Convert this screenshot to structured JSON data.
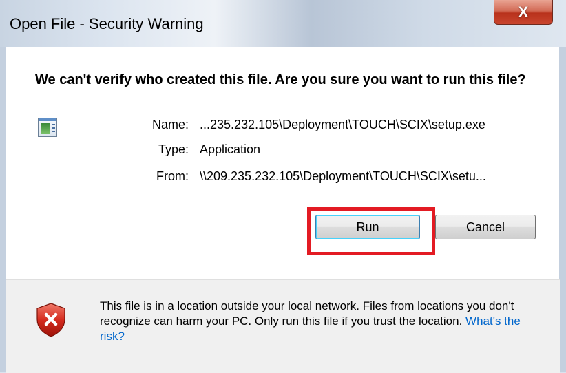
{
  "window": {
    "title": "Open File - Security Warning",
    "close_glyph": "X"
  },
  "dialog": {
    "heading": "We can't verify who created this file. Are you sure you want to run this file?",
    "file_icon": "application-file-icon",
    "fields": {
      "name_label": "Name:",
      "name_value": "...235.232.105\\Deployment\\TOUCH\\SCIX\\setup.exe",
      "type_label": "Type:",
      "type_value": "Application",
      "from_label": "From:",
      "from_value": "\\\\209.235.232.105\\Deployment\\TOUCH\\SCIX\\setu..."
    },
    "buttons": {
      "run_label": "Run",
      "cancel_label": "Cancel"
    }
  },
  "footer": {
    "warning_icon": "shield-error-icon",
    "message": "This file is in a location outside your local network. Files from locations you don't recognize can harm your PC. Only run this file if you trust the location. ",
    "link_text": "What's the risk?"
  },
  "colors": {
    "highlight_border": "#e31b23",
    "link": "#0066cc",
    "close_button": "#c9452e"
  }
}
